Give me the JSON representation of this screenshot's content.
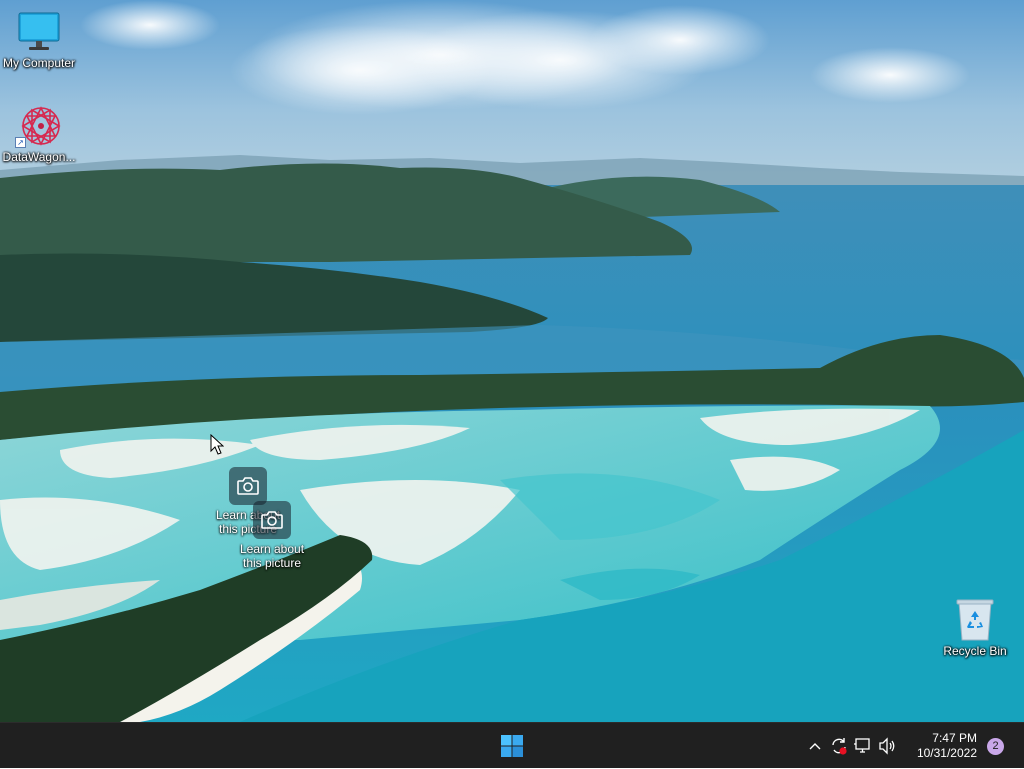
{
  "desktop": {
    "icons": [
      {
        "label": "My Computer",
        "icon": "monitor-icon"
      },
      {
        "label": "DataWagon...",
        "icon": "datawagon-logo-icon",
        "shortcut": true
      },
      {
        "label": "Recycle Bin",
        "icon": "recycle-bin-icon"
      }
    ],
    "learn_icons": [
      {
        "line1": "Learn about",
        "line2": "this picture",
        "icon": "camera-icon"
      },
      {
        "line1": "Learn about",
        "line2": "this picture",
        "icon": "camera-icon"
      }
    ]
  },
  "taskbar": {
    "start_icon": "windows-logo-icon",
    "tray_icons": [
      "chevron-up-icon",
      "sync-error-icon",
      "network-icon",
      "volume-icon"
    ],
    "time": "7:47 PM",
    "date": "10/31/2022",
    "notification_count": "2"
  },
  "colors": {
    "taskbar_bg": "#202020",
    "accent": "#4cc2ff",
    "badge": "#c9a7e9"
  }
}
